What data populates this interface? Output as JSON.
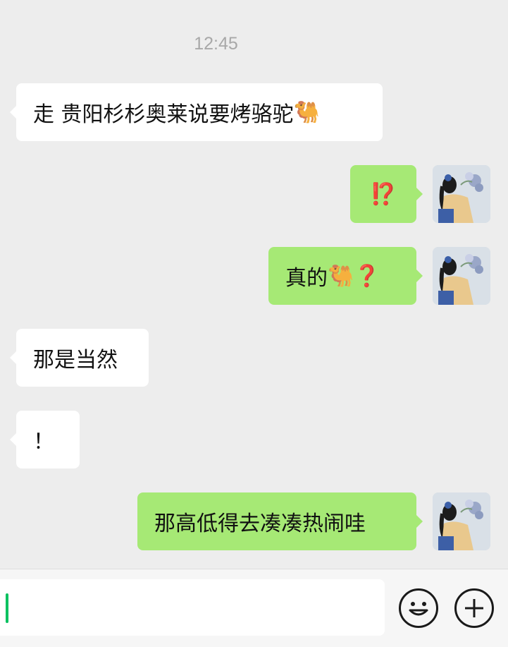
{
  "chat": {
    "timestamp": "12:45",
    "messages": [
      {
        "side": "in",
        "text": "走 贵阳杉杉奥莱说要烤骆驼",
        "emoji": "🐫"
      },
      {
        "side": "out",
        "text": "⁉️"
      },
      {
        "side": "out",
        "text": "真的",
        "emoji": "🐫",
        "mark": "❓"
      },
      {
        "side": "in",
        "text": "那是当然"
      },
      {
        "side": "in",
        "text": "！"
      },
      {
        "side": "out",
        "text": "那高低得去凑凑热闹哇"
      }
    ]
  },
  "input_bar": {
    "value": "",
    "emoji_icon": "smiley-face-icon",
    "more_icon": "plus-circle-icon"
  },
  "colors": {
    "background": "#ededed",
    "incoming_bubble": "#ffffff",
    "outgoing_bubble": "#a6e975",
    "caret": "#07c160"
  }
}
